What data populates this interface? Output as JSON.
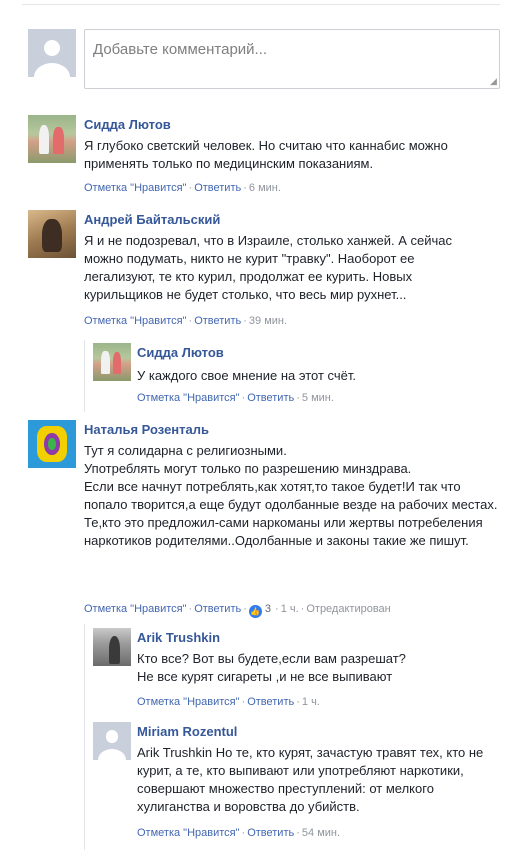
{
  "composer": {
    "placeholder": "Добавьте комментарий..."
  },
  "actions": {
    "like": "Отметка \"Нравится\"",
    "reply": "Ответить",
    "separator": "·"
  },
  "comments": [
    {
      "author": "Сидда Лютов",
      "text": "Я глубоко светский человек. Но считаю что каннабис можно применять только по медицинским показаниям.",
      "time": "6 мин."
    },
    {
      "author": "Андрей Байтальский",
      "text": "Я и не подозревал, что в Израиле, столько ханжей. А сейчас можно подумать, никто не курит \"травку\". Наоборот ее легализуют, те кто курил, продолжат ее курить. Новых курильщиков не будет столько, что весь мир рухнет...",
      "time": "39 мин.",
      "replies": [
        {
          "author": "Сидда Лютов",
          "text": "У каждого свое мнение на этот счёт.",
          "time": "5 мин."
        }
      ]
    },
    {
      "author": "Наталья Розенталь",
      "text": "Тут я солидарна с религиозными.\nУпотреблять могут только по разрешению минздрава.\nЕсли все начнут потреблять,как хотят,то такое будет!И так что попало творится,а еще будут одолбанные везде на рабочих местах.\nТе,кто это предложил-сами наркоманы или жертвы потребеления наркотиков родителями..Одолбанные и законы такие же пишут.",
      "like_count": "3",
      "time": "1 ч.",
      "edited": "Отредактирован",
      "replies": [
        {
          "author": "Arik Trushkin",
          "text": "Кто все? Вот вы будете,если вам разрешат?\nНе все курят сигареты ,и не все выпивают",
          "time": "1 ч."
        },
        {
          "author": "Miriam Rozentul",
          "text": "Arik Trushkin Но те, кто курят, зачастую травят тех, кто не курит, а те, кто выпивают или употребляют наркотики, совершают множество преступлений: от мелкого хулиганства и воровства до убийств.",
          "time": "54 мин."
        }
      ]
    }
  ]
}
